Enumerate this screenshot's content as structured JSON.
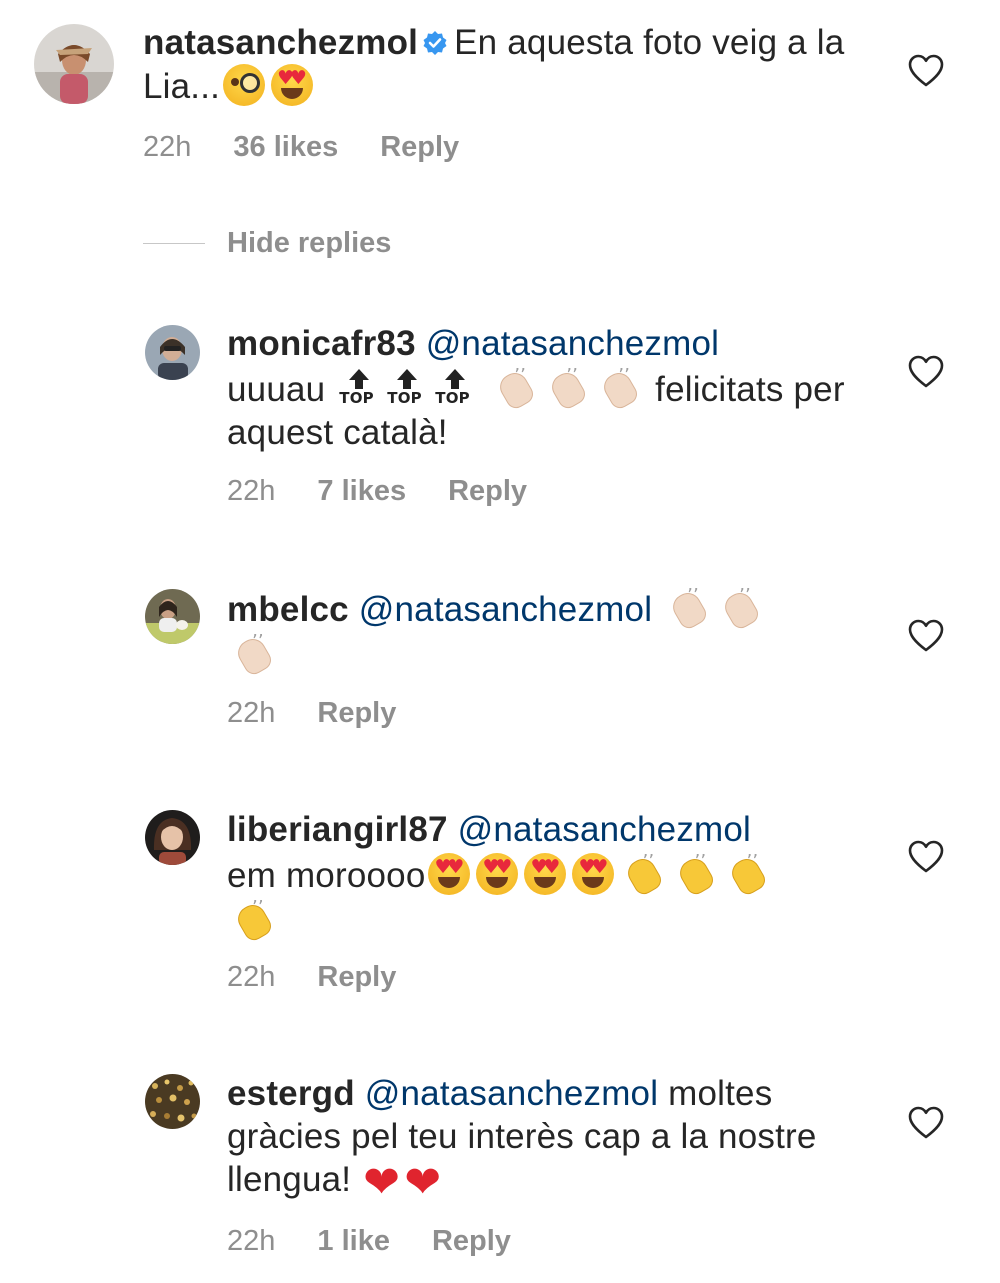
{
  "colors": {
    "username": "#262626",
    "mention": "#00376b",
    "meta_text": "#8e8e8e",
    "verified_badge": "#3897f0",
    "heart_outline": "#262626"
  },
  "icons": {
    "like": "heart-outline-icon",
    "verified": "verified-badge-icon"
  },
  "parent_comment": {
    "username": "natasanchezmol",
    "verified": true,
    "text": "En aquesta foto veig a la Lia...",
    "emojis": [
      "face-with-monocle",
      "smiling-face-with-heart-eyes"
    ],
    "time": "22h",
    "likes": "36 likes",
    "reply": "Reply"
  },
  "hide_replies": "Hide replies",
  "replies": [
    {
      "username": "monicafr83",
      "mention": "@natasanchezmol",
      "text_before": "uuuau",
      "emojis": [
        "top-arrow",
        "top-arrow",
        "top-arrow",
        "clapping-hands-light",
        "clapping-hands-light",
        "clapping-hands-light"
      ],
      "top_label": "TOP",
      "text_after": "felicitats per aquest català!",
      "time": "22h",
      "likes": "7 likes",
      "reply": "Reply"
    },
    {
      "username": "mbelcc",
      "mention": "@natasanchezmol",
      "emojis": [
        "clapping-hands-light",
        "clapping-hands-light",
        "clapping-hands-light"
      ],
      "time": "22h",
      "reply": "Reply"
    },
    {
      "username": "liberiangirl87",
      "mention": "@natasanchezmol",
      "text": "em moroooo",
      "emojis": [
        "smiling-face-with-heart-eyes",
        "smiling-face-with-heart-eyes",
        "smiling-face-with-heart-eyes",
        "smiling-face-with-heart-eyes",
        "clapping-hands",
        "clapping-hands",
        "clapping-hands",
        "clapping-hands"
      ],
      "time": "22h",
      "reply": "Reply"
    },
    {
      "username": "estergd",
      "mention": "@natasanchezmol",
      "text": "moltes gràcies pel teu interès cap a la nostre llengua!",
      "emojis": [
        "red-heart",
        "red-heart"
      ],
      "time": "22h",
      "likes": "1 like",
      "reply": "Reply"
    }
  ]
}
